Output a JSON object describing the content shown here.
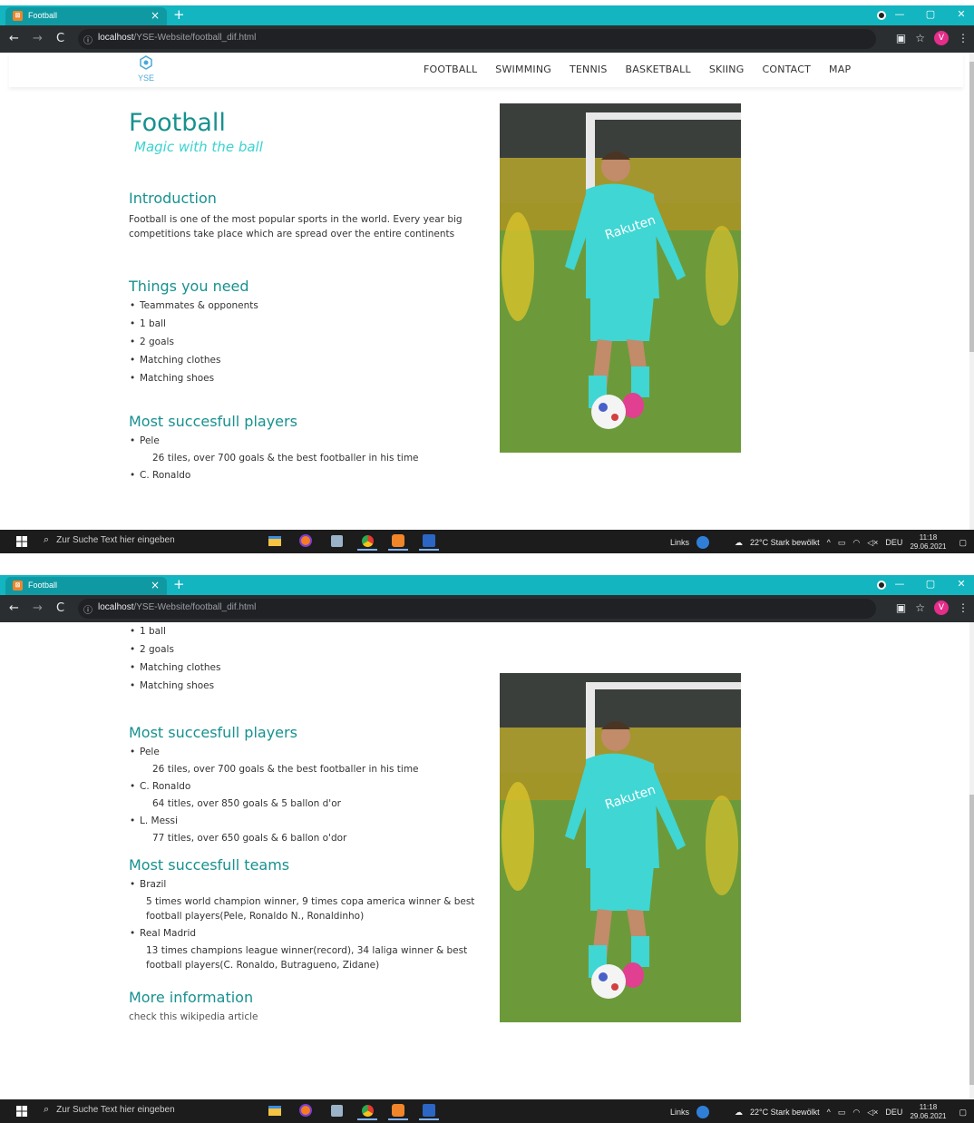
{
  "browser": {
    "tab_title": "Football",
    "tab_favicon": "XAMPP",
    "url_host": "localhost",
    "url_path": "/YSE-Website/football_dif.html",
    "avatar_letter": "V"
  },
  "site": {
    "logo_text": "YSE",
    "nav": [
      "FOOTBALL",
      "SWIMMING",
      "TENNIS",
      "BASKETBALL",
      "SKIING",
      "CONTACT",
      "MAP"
    ]
  },
  "page": {
    "title": "Football",
    "subtitle": "Magic with the ball",
    "intro_heading": "Introduction",
    "intro_text": "Football is one of the most popular sports in the world. Every year big competitions take place which are spread over the entire continents",
    "needs_heading": "Things you need",
    "needs": [
      "Teammates & opponents",
      "1 ball",
      "2 goals",
      "Matching clothes",
      "Matching shoes"
    ],
    "players_heading": "Most succesfull players",
    "players": [
      {
        "name": "Pele",
        "desc": "26 tiles, over 700 goals & the best footballer in his time"
      },
      {
        "name": "C. Ronaldo",
        "desc": "64 titles, over 850 goals & 5 ballon d'or"
      },
      {
        "name": "L. Messi",
        "desc": "77 titles, over 650 goals & 6 ballon o'dor"
      }
    ],
    "teams_heading": "Most succesfull teams",
    "teams": [
      {
        "name": "Brazil",
        "desc": "5 times world champion winner, 9 times copa america winner & best football players(Pele, Ronaldo N., Ronaldinho)"
      },
      {
        "name": "Real Madrid",
        "desc": "13 times champions league winner(record), 34 laliga winner & best football players(C. Ronaldo, Butragueno, Zidane)"
      }
    ],
    "more_heading": "More information",
    "more_text": "check this wikipedia article",
    "image_icon": "football-player-photo"
  },
  "taskbar": {
    "search_placeholder": "Zur Suche Text hier eingeben",
    "links_label": "Links",
    "weather": "22°C  Stark bewölkt",
    "lang": "DEU",
    "time": "11:18",
    "date": "29.06.2021"
  },
  "colors": {
    "tab_bar": "#12b5c0",
    "heading": "#17918f",
    "subtitle": "#3ad3d0"
  }
}
